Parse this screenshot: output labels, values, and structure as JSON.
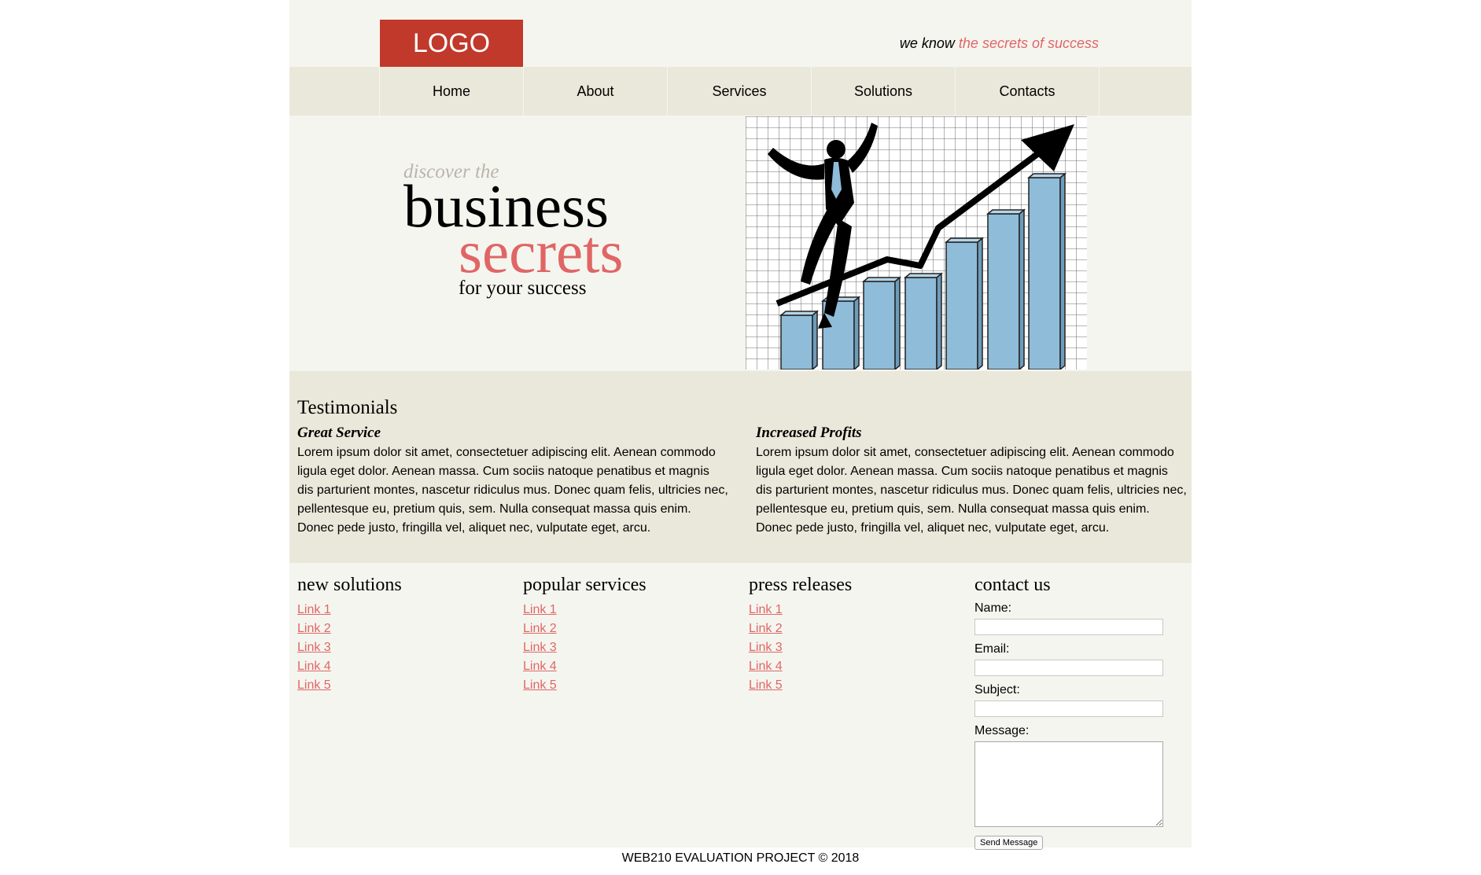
{
  "header": {
    "logo": "LOGO",
    "tagline_prefix": "we know ",
    "tagline_accent": "the secrets of success"
  },
  "nav": {
    "items": [
      "Home",
      "About",
      "Services",
      "Solutions",
      "Contacts"
    ]
  },
  "hero": {
    "line1": "discover the",
    "line2": "business",
    "line3": "secrets",
    "line4": "for your success",
    "image_icon": "business-success-illustration"
  },
  "testimonials": {
    "title": "Testimonials",
    "items": [
      {
        "heading": "Great Service",
        "text": "Lorem ipsum dolor sit amet, consectetuer adipiscing elit. Aenean commodo ligula eget dolor. Aenean massa. Cum sociis natoque penatibus et magnis dis parturient montes, nascetur ridiculus mus. Donec quam felis, ultricies nec, pellentesque eu, pretium quis, sem. Nulla consequat massa quis enim. Donec pede justo, fringilla vel, aliquet nec, vulputate eget, arcu."
      },
      {
        "heading": "Increased Profits",
        "text": "Lorem ipsum dolor sit amet, consectetuer adipiscing elit. Aenean commodo ligula eget dolor. Aenean massa. Cum sociis natoque penatibus et magnis dis parturient montes, nascetur ridiculus mus. Donec quam felis, ultricies nec, pellentesque eu, pretium quis, sem. Nulla consequat massa quis enim. Donec pede justo, fringilla vel, aliquet nec, vulputate eget, arcu."
      }
    ]
  },
  "columns": [
    {
      "title": "new solutions",
      "links": [
        "Link 1",
        "Link 2",
        "Link 3",
        "Link 4",
        "Link 5"
      ]
    },
    {
      "title": "popular services",
      "links": [
        "Link 1",
        "Link 2",
        "Link 3",
        "Link 4",
        "Link 5"
      ]
    },
    {
      "title": "press releases",
      "links": [
        "Link 1",
        "Link 2",
        "Link 3",
        "Link 4",
        "Link 5"
      ]
    }
  ],
  "contact": {
    "title": "contact us",
    "name_label": "Name:",
    "email_label": "Email:",
    "subject_label": "Subject:",
    "message_label": "Message:",
    "name_value": "",
    "email_value": "",
    "subject_value": "",
    "send_label": "Send Message"
  },
  "footer": {
    "text": "WEB210 EVALUATION PROJECT © 2018"
  },
  "colors": {
    "accent": "#e06666",
    "logo_bg": "#c0392b",
    "band": "#eae8da",
    "page_bg": "#f5f5ef"
  }
}
